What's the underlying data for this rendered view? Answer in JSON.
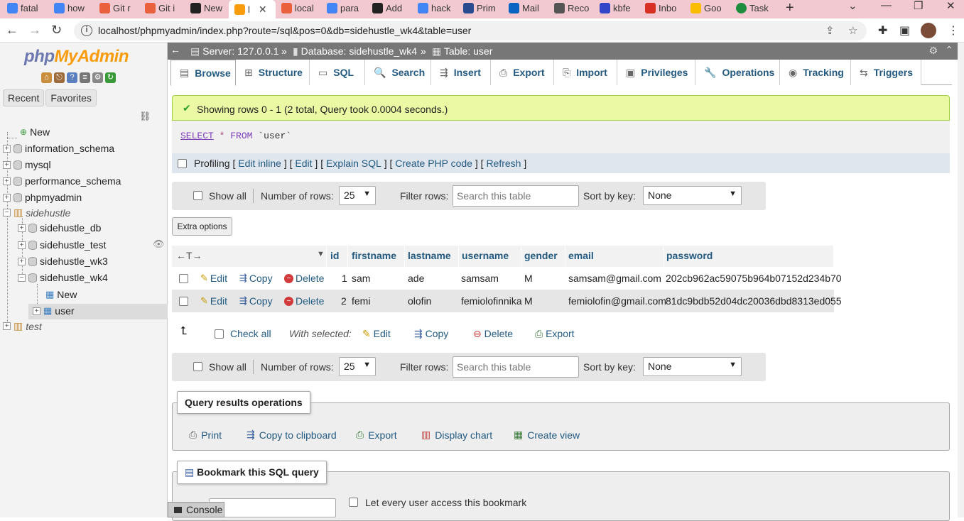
{
  "browser": {
    "tabs": [
      {
        "label": "fatal",
        "color": "#4285f4"
      },
      {
        "label": "how",
        "color": "#4285f4"
      },
      {
        "label": "Git r",
        "color": "#e8603c"
      },
      {
        "label": "Git i",
        "color": "#e8603c"
      },
      {
        "label": "New",
        "color": "#222222"
      },
      {
        "label": "l",
        "color": "#f89c0e",
        "active": true
      },
      {
        "label": "local",
        "color": "#e8603c"
      },
      {
        "label": "para",
        "color": "#4285f4"
      },
      {
        "label": "Add",
        "color": "#222222"
      },
      {
        "label": "hack",
        "color": "#4285f4"
      },
      {
        "label": "Prim",
        "color": "#2a4b8d"
      },
      {
        "label": "Mail",
        "color": "#0a64c2"
      },
      {
        "label": "Reco",
        "color": "#555555"
      },
      {
        "label": "kbfe",
        "color": "#3346c8"
      },
      {
        "label": "Inbo",
        "color": "#d93025"
      },
      {
        "label": "Goo",
        "color": "#fbbc04"
      },
      {
        "label": "Task",
        "color": "#1e8e3e"
      }
    ],
    "url": "localhost/phpmyadmin/index.php?route=/sql&pos=0&db=sidehustle_wk4&table=user"
  },
  "leftnav": {
    "logo_php": "php",
    "logo_myadmin": "MyAdmin",
    "tab_recent": "Recent",
    "tab_favorites": "Favorites",
    "tree": [
      {
        "label": "New",
        "level": 0
      },
      {
        "label": "information_schema",
        "level": 0
      },
      {
        "label": "mysql",
        "level": 0
      },
      {
        "label": "performance_schema",
        "level": 0
      },
      {
        "label": "phpmyadmin",
        "level": 0
      },
      {
        "label": "sidehustle",
        "level": 0
      },
      {
        "label": "sidehustle_db",
        "level": 1
      },
      {
        "label": "sidehustle_test",
        "level": 1
      },
      {
        "label": "sidehustle_wk3",
        "level": 1
      },
      {
        "label": "sidehustle_wk4",
        "level": 1
      },
      {
        "label": "New",
        "level": 2
      },
      {
        "label": "user",
        "level": 2
      },
      {
        "label": "test",
        "level": 0
      }
    ]
  },
  "breadcrumb": {
    "server": "Server: 127.0.0.1",
    "database": "Database: sidehustle_wk4",
    "table": "Table: user",
    "sep": "»"
  },
  "tabs": [
    "Browse",
    "Structure",
    "SQL",
    "Search",
    "Insert",
    "Export",
    "Import",
    "Privileges",
    "Operations",
    "Tracking",
    "Triggers"
  ],
  "success": "Showing rows 0 - 1 (2 total, Query took 0.0004 seconds.)",
  "sql": {
    "kw": "SELECT",
    "star": "*",
    "from": "FROM",
    "table": "`user`"
  },
  "profiling": {
    "label": "Profiling",
    "edit_inline": "Edit inline",
    "edit": "Edit",
    "explain": "Explain SQL",
    "create_php": "Create PHP code",
    "refresh": "Refresh"
  },
  "nav": {
    "show_all": "Show all",
    "num_rows_label": "Number of rows:",
    "num_rows": "25",
    "filter_label": "Filter rows:",
    "filter_placeholder": "Search this table",
    "sort_label": "Sort by key:",
    "sort_value": "None"
  },
  "extra_options": "Extra options",
  "table": {
    "sort_arrows": "←T→",
    "columns": [
      "id",
      "firstname",
      "lastname",
      "username",
      "gender",
      "email",
      "password"
    ],
    "actions": {
      "edit": "Edit",
      "copy": "Copy",
      "delete": "Delete"
    },
    "rows": [
      [
        "1",
        "sam",
        "ade",
        "samsam",
        "M",
        "samsam@gmail.com",
        "202cb962ac59075b964b07152d234b70"
      ],
      [
        "2",
        "femi",
        "olofin",
        "femiolofinnika",
        "M",
        "femiolofin@gmail.com",
        "81dc9bdb52d04dc20036dbd8313ed055"
      ]
    ]
  },
  "with_selected": {
    "check_all": "Check all",
    "label": "With selected:",
    "edit": "Edit",
    "copy": "Copy",
    "delete": "Delete",
    "export": "Export"
  },
  "query_ops": {
    "legend": "Query results operations",
    "print": "Print",
    "copy_clipboard": "Copy to clipboard",
    "export": "Export",
    "display_chart": "Display chart",
    "create_view": "Create view"
  },
  "bookmark": {
    "legend": "Bookmark this SQL query",
    "let_every": "Let every user access this bookmark"
  },
  "console": "Console"
}
